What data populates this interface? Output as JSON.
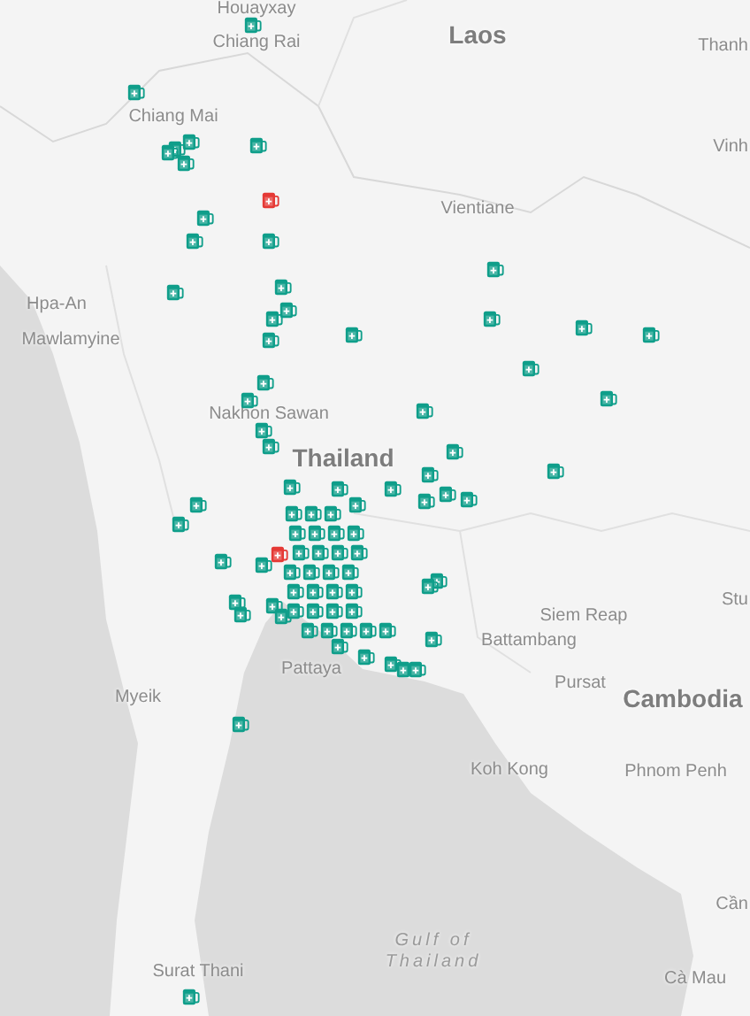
{
  "map": {
    "labels": [
      {
        "text": "Houayxay",
        "kind": "city"
      },
      {
        "text": "Chiang Rai",
        "kind": "city"
      },
      {
        "text": "Laos",
        "kind": "country"
      },
      {
        "text": "Thanh",
        "kind": "city"
      },
      {
        "text": "Vinh",
        "kind": "city"
      },
      {
        "text": "Chiang Mai",
        "kind": "city"
      },
      {
        "text": "Vientiane",
        "kind": "city"
      },
      {
        "text": "Hpa-An",
        "kind": "city"
      },
      {
        "text": "Mawlamyine",
        "kind": "city"
      },
      {
        "text": "Nakhon Sawan",
        "kind": "city"
      },
      {
        "text": "Thailand",
        "kind": "country"
      },
      {
        "text": "Stu",
        "kind": "city"
      },
      {
        "text": "Siem Reap",
        "kind": "city"
      },
      {
        "text": "Battambang",
        "kind": "city"
      },
      {
        "text": "Pattaya",
        "kind": "city"
      },
      {
        "text": "Myeik",
        "kind": "city"
      },
      {
        "text": "Pursat",
        "kind": "city"
      },
      {
        "text": "Cambodia",
        "kind": "country"
      },
      {
        "text": "Koh Kong",
        "kind": "city"
      },
      {
        "text": "Phnom Penh",
        "kind": "city"
      },
      {
        "text": "Cần",
        "kind": "city"
      },
      {
        "text": "Gulf of Thailand",
        "kind": "sea"
      },
      {
        "text": "Surat Thani",
        "kind": "city"
      },
      {
        "text": "Cà Mau",
        "kind": "city"
      }
    ],
    "pins": [
      {
        "color": "#0f9e8a"
      },
      {
        "color": "#0f9e8a"
      },
      {
        "color": "#0f9e8a"
      },
      {
        "color": "#0f9e8a"
      },
      {
        "color": "#0f9e8a"
      },
      {
        "color": "#0f9e8a"
      },
      {
        "color": "#0f9e8a"
      },
      {
        "color": "#e53935"
      },
      {
        "color": "#0f9e8a"
      },
      {
        "color": "#0f9e8a"
      },
      {
        "color": "#0f9e8a"
      },
      {
        "color": "#0f9e8a"
      },
      {
        "color": "#0f9e8a"
      },
      {
        "color": "#0f9e8a"
      },
      {
        "color": "#0f9e8a"
      },
      {
        "color": "#0f9e8a"
      },
      {
        "color": "#0f9e8a"
      },
      {
        "color": "#0f9e8a"
      },
      {
        "color": "#0f9e8a"
      },
      {
        "color": "#0f9e8a"
      },
      {
        "color": "#0f9e8a"
      },
      {
        "color": "#0f9e8a"
      },
      {
        "color": "#0f9e8a"
      },
      {
        "color": "#0f9e8a"
      },
      {
        "color": "#0f9e8a"
      },
      {
        "color": "#0f9e8a"
      },
      {
        "color": "#0f9e8a"
      },
      {
        "color": "#0f9e8a"
      },
      {
        "color": "#0f9e8a"
      },
      {
        "color": "#0f9e8a"
      },
      {
        "color": "#0f9e8a"
      },
      {
        "color": "#0f9e8a"
      },
      {
        "color": "#0f9e8a"
      },
      {
        "color": "#0f9e8a"
      },
      {
        "color": "#0f9e8a"
      },
      {
        "color": "#0f9e8a"
      },
      {
        "color": "#0f9e8a"
      },
      {
        "color": "#0f9e8a"
      },
      {
        "color": "#0f9e8a"
      },
      {
        "color": "#0f9e8a"
      },
      {
        "color": "#0f9e8a"
      },
      {
        "color": "#0f9e8a"
      },
      {
        "color": "#0f9e8a"
      },
      {
        "color": "#0f9e8a"
      },
      {
        "color": "#0f9e8a"
      },
      {
        "color": "#0f9e8a"
      },
      {
        "color": "#0f9e8a"
      },
      {
        "color": "#0f9e8a"
      },
      {
        "color": "#0f9e8a"
      },
      {
        "color": "#0f9e8a"
      },
      {
        "color": "#0f9e8a"
      },
      {
        "color": "#e53935"
      },
      {
        "color": "#0f9e8a"
      },
      {
        "color": "#0f9e8a"
      },
      {
        "color": "#0f9e8a"
      },
      {
        "color": "#0f9e8a"
      },
      {
        "color": "#0f9e8a"
      },
      {
        "color": "#0f9e8a"
      },
      {
        "color": "#0f9e8a"
      },
      {
        "color": "#0f9e8a"
      },
      {
        "color": "#0f9e8a"
      },
      {
        "color": "#0f9e8a"
      },
      {
        "color": "#0f9e8a"
      },
      {
        "color": "#0f9e8a"
      },
      {
        "color": "#0f9e8a"
      },
      {
        "color": "#0f9e8a"
      },
      {
        "color": "#0f9e8a"
      },
      {
        "color": "#0f9e8a"
      },
      {
        "color": "#0f9e8a"
      },
      {
        "color": "#0f9e8a"
      },
      {
        "color": "#0f9e8a"
      },
      {
        "color": "#0f9e8a"
      },
      {
        "color": "#0f9e8a"
      },
      {
        "color": "#0f9e8a"
      },
      {
        "color": "#0f9e8a"
      },
      {
        "color": "#0f9e8a"
      },
      {
        "color": "#0f9e8a"
      },
      {
        "color": "#0f9e8a"
      },
      {
        "color": "#0f9e8a"
      },
      {
        "color": "#0f9e8a"
      },
      {
        "color": "#0f9e8a"
      },
      {
        "color": "#0f9e8a"
      },
      {
        "color": "#0f9e8a"
      },
      {
        "color": "#0f9e8a"
      },
      {
        "color": "#0f9e8a"
      }
    ]
  }
}
